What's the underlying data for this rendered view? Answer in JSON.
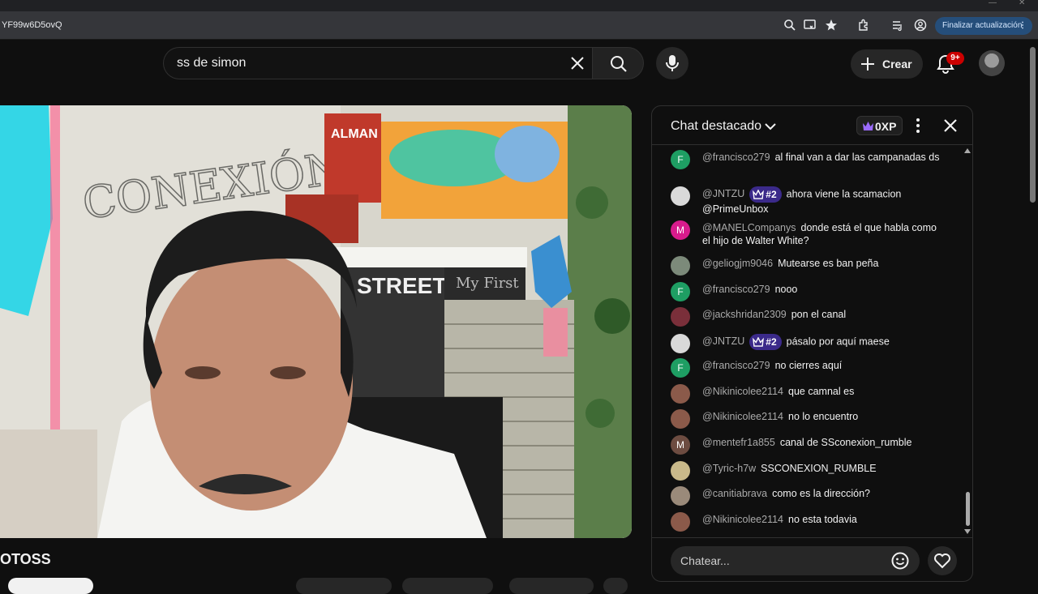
{
  "browser": {
    "url_fragment": "YF99w6D5ovQ",
    "update_button_label": "Finalizar actualización",
    "update_button_more": "⋮"
  },
  "header": {
    "search_query": "ss de simon",
    "create_label": "Crear",
    "notification_count": "9+"
  },
  "video": {
    "channel_title_fragment": "OTOSS",
    "overlay_text_conexion": "CONEXIÓN",
    "overlay_text_street": "STREET",
    "overlay_text_myfirst": "My First",
    "overlay_text_almanac": "ALMAN"
  },
  "chat": {
    "title": "Chat destacado",
    "xp_label": "0XP",
    "input_placeholder": "Chatear...",
    "messages": [
      {
        "author": "@francisco279",
        "badge": "",
        "text": "al final van a dar las campanadas ds",
        "avatar_letter": "F",
        "avatar_color": "#1e9e63"
      },
      {
        "author": "@JNTZU",
        "badge": "#2",
        "text": "ahora viene la scamacion @PrimeUnbox",
        "avatar_letter": "",
        "avatar_color": "#d9d9d9"
      },
      {
        "author": "@MANELCompanys",
        "badge": "",
        "text": "donde está el que habla como el hijo de Walter White?",
        "avatar_letter": "M",
        "avatar_color": "#d81b8c"
      },
      {
        "author": "@geliogjm9046",
        "badge": "",
        "text": "Mutearse es ban peña",
        "avatar_letter": "",
        "avatar_color": "#7c8a7a"
      },
      {
        "author": "@francisco279",
        "badge": "",
        "text": "nooo",
        "avatar_letter": "F",
        "avatar_color": "#1e9e63"
      },
      {
        "author": "@jackshridan2309",
        "badge": "",
        "text": "pon el canal",
        "avatar_letter": "",
        "avatar_color": "#7a2f3a"
      },
      {
        "author": "@JNTZU",
        "badge": "#2",
        "text": "pásalo por aquí maese",
        "avatar_letter": "",
        "avatar_color": "#d9d9d9"
      },
      {
        "author": "@francisco279",
        "badge": "",
        "text": "no cierres aquí",
        "avatar_letter": "F",
        "avatar_color": "#1e9e63"
      },
      {
        "author": "@Nikinicolee2114",
        "badge": "",
        "text": "que camnal es",
        "avatar_letter": "",
        "avatar_color": "#8b5a4a"
      },
      {
        "author": "@Nikinicolee2114",
        "badge": "",
        "text": "no lo encuentro",
        "avatar_letter": "",
        "avatar_color": "#8b5a4a"
      },
      {
        "author": "@mentefr1a855",
        "badge": "",
        "text": "canal de SSconexion_rumble",
        "avatar_letter": "M",
        "avatar_color": "#6d4c41"
      },
      {
        "author": "@Tyric-h7w",
        "badge": "",
        "text": "SSCONEXION_RUMBLE",
        "avatar_letter": "",
        "avatar_color": "#c9b98a"
      },
      {
        "author": "@canitiabrava",
        "badge": "",
        "text": "como es la dirección?",
        "avatar_letter": "",
        "avatar_color": "#9a8a7a"
      },
      {
        "author": "@Nikinicolee2114",
        "badge": "",
        "text": "no esta todavia",
        "avatar_letter": "",
        "avatar_color": "#8b5a4a"
      }
    ]
  },
  "colors": {
    "background": "#0f0f0f",
    "badge_purple": "#3b2a8a",
    "notification_red": "#cc0000",
    "update_blue": "#254e7a"
  }
}
